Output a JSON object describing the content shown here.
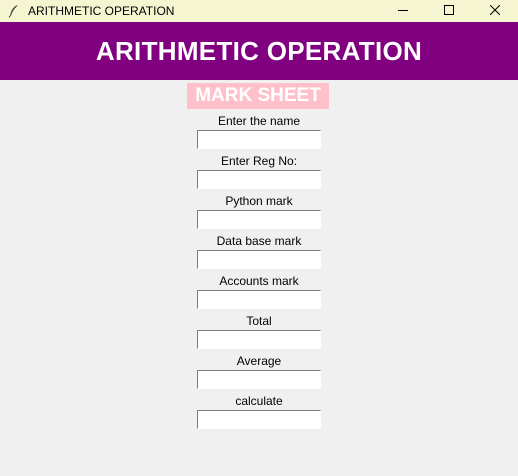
{
  "window": {
    "title": "ARITHMETIC OPERATION",
    "icon": "feather-icon",
    "controls": [
      "minimize-icon",
      "maximize-icon",
      "close-icon"
    ]
  },
  "header": {
    "title": "ARITHMETIC OPERATION",
    "background": "#800080",
    "color": "#ffffff"
  },
  "subheader": {
    "title": "MARK SHEET",
    "background": "#ffc0cb",
    "color": "#ffffff"
  },
  "fields": [
    {
      "label": "Enter the name",
      "value": ""
    },
    {
      "label": "Enter Reg No:",
      "value": ""
    },
    {
      "label": "Python mark",
      "value": ""
    },
    {
      "label": "Data base mark",
      "value": ""
    },
    {
      "label": "Accounts mark",
      "value": ""
    },
    {
      "label": "Total",
      "value": ""
    },
    {
      "label": "Average",
      "value": ""
    },
    {
      "label": "calculate",
      "value": ""
    }
  ]
}
